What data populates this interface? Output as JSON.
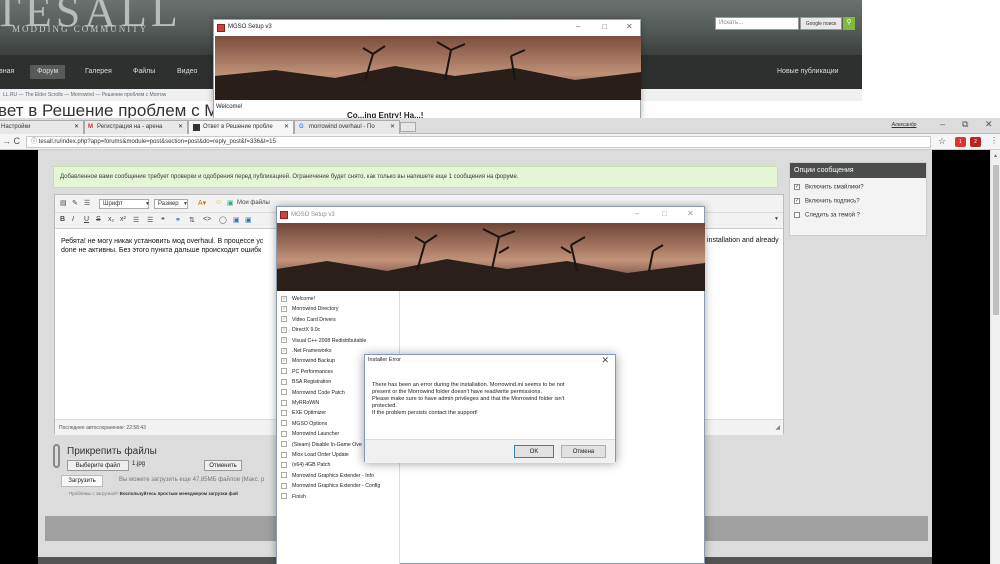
{
  "bg_site": {
    "logo": "TESALL",
    "logo_sub": "MODDING COMMUNITY",
    "search_placeholder": "Искать...",
    "search_button": "Google поиск",
    "nav": [
      "вная",
      "Форум",
      "Галерея",
      "Файлы",
      "Видео"
    ],
    "nav_right": "Новые публикации",
    "breadcrumbs": "LL.RU — The Elder Scrolls — Morrowind — Решение проблем с Morrow",
    "title": "вет в Решение проблем с Morrow",
    "mgso_title": "MGSO Setup v3",
    "mgso_welcome": "Welcome!",
    "mgso_heading_cut": "Co...ing Entry! Ha...!"
  },
  "browser": {
    "tabs": [
      {
        "label": "Настройки",
        "active": false
      },
      {
        "label": "Регистрация на - арена",
        "active": false
      },
      {
        "label": "Ответ в Решение пробле",
        "active": true
      },
      {
        "label": "morrowind overhaul - По",
        "active": false
      }
    ],
    "profile": "Александр",
    "url": "tesall.ru/index.php?app=forums&module=post&section=post&do=reply_post&f=336&t=15"
  },
  "page": {
    "notice": "Добавленное вами сообщение требует проверки и одобрения перед публикацией. Ограничение будет снято, как только вы напишете еще 1 сообщения на форуме.",
    "toolbar": {
      "font": "Шрифт",
      "size": "Размер",
      "my_files": "Мои файлы"
    },
    "editor_text_1": "Ребята! не могу никак установить мод overhaul. В процессе ус",
    "editor_text_1b": "installation and already",
    "editor_text_2": "done не активны. Без этого пункта дальше происходит ошибк",
    "autosave": "Последнее автосохранение: 22:58:43",
    "attach_title": "Прикрепить файлы",
    "choose_file": "Выберите файл",
    "file_name": "1.jpg",
    "cancel_upload": "Отменить",
    "upload_button": "Загрузить",
    "upload_info": "Вы можете загрузить еще 47,85МБ файлов (Макс. р",
    "upload_help_q": "Проблемы с загрузкой?",
    "upload_help": "Воспользуйтесь простым менеджером загрузки фай",
    "options": {
      "header": "Опции сообщения",
      "items": [
        {
          "label": "Включить смайлики?",
          "checked": true
        },
        {
          "label": "Включить подпись?",
          "checked": true
        },
        {
          "label": "Следить за темой ?",
          "checked": false
        }
      ]
    }
  },
  "mgso": {
    "title": "MGSO Setup v3",
    "steps": [
      {
        "label": "Welcome!",
        "done": true
      },
      {
        "label": "Morrowind Directory",
        "done": true
      },
      {
        "label": "Video Card Drivers",
        "done": true
      },
      {
        "label": "DirectX 9.0c",
        "done": true
      },
      {
        "label": "Visual C++ 2008 Redistributable",
        "done": true
      },
      {
        "label": ".Net Frameworks",
        "done": true
      },
      {
        "label": "Morrowind Backup",
        "done": true
      },
      {
        "label": "PC Performances",
        "done": false
      },
      {
        "label": "BSA Registration",
        "done": false
      },
      {
        "label": "Morrowind Code Patch",
        "done": false
      },
      {
        "label": "MyRRoWiN",
        "done": false
      },
      {
        "label": "EXE Optimizer",
        "done": false
      },
      {
        "label": "MGSO Options",
        "done": false
      },
      {
        "label": "Morrowind Launcher",
        "done": false
      },
      {
        "label": "(Steam) Disable In-Game Ove",
        "done": false
      },
      {
        "label": "Mlox Load Order Update",
        "done": false
      },
      {
        "label": "(x64) 4GB Patch",
        "done": false
      },
      {
        "label": "Morrowind Graphics Extender - Info",
        "done": false
      },
      {
        "label": "Morrowind Graphics Extender - Config",
        "done": false
      },
      {
        "label": "Finish",
        "done": false
      }
    ]
  },
  "error_dialog": {
    "title": "Installer Error",
    "message_lines": [
      "There has been an error during the installation. Morrowind.ini seems to be not",
      "present or the Morrowind folder doesn't have read/write permissions.",
      "Please make sure to have admin privileges and that the Morrowind folder isn't",
      "protected.",
      "If the problem persists contact the support!"
    ],
    "ok": "OK",
    "cancel": "Отмена"
  }
}
